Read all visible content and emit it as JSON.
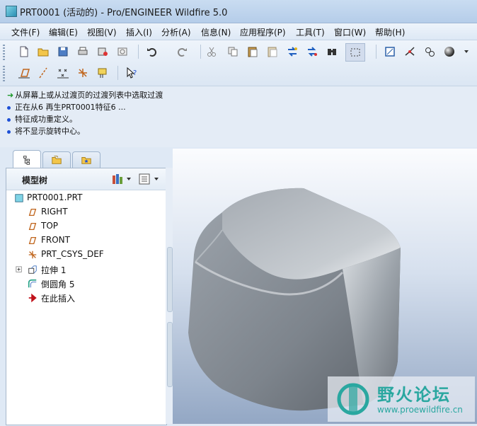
{
  "window": {
    "title": "PRT0001 (活动的) - Pro/ENGINEER Wildfire 5.0"
  },
  "menu": [
    {
      "label": "文件(F)"
    },
    {
      "label": "编辑(E)"
    },
    {
      "label": "视图(V)"
    },
    {
      "label": "插入(I)"
    },
    {
      "label": "分析(A)"
    },
    {
      "label": "信息(N)"
    },
    {
      "label": "应用程序(P)"
    },
    {
      "label": "工具(T)"
    },
    {
      "label": "窗口(W)"
    },
    {
      "label": "帮助(H)"
    }
  ],
  "toolbar": {
    "row1_icons": [
      "new-file-icon",
      "open-folder-icon",
      "save-icon",
      "print-icon",
      "save-copy-icon",
      "close-window-icon",
      "undo-icon",
      "redo-icon",
      "cut-icon",
      "copy-icon",
      "paste-icon",
      "paste-special-icon",
      "regenerate-icon",
      "regen-manager-icon",
      "find-icon",
      "select-box-icon",
      "repaint-icon",
      "spin-center-icon",
      "orient-icon",
      "shading-icon"
    ],
    "row2_icons": [
      "datum-plane-icon",
      "datum-axis-icon",
      "datum-point-icon",
      "datum-csys-icon",
      "annotation-icon",
      "context-help-icon"
    ]
  },
  "messages": [
    {
      "type": "prompt",
      "text": "从屏幕上或从过渡页的过渡列表中选取过渡"
    },
    {
      "type": "info",
      "text": "正在从6 再生PRT0001特征6 ..."
    },
    {
      "type": "info",
      "text": "特征成功重定义。"
    },
    {
      "type": "info",
      "text": "将不显示旋转中心。"
    }
  ],
  "panel": {
    "title": "模型树",
    "tabs": [
      "model-tree-tab-icon",
      "folder-browser-tab-icon",
      "favorites-tab-icon"
    ],
    "tree": [
      {
        "label": "PRT0001.PRT",
        "icon": "part-icon"
      },
      {
        "label": "RIGHT",
        "icon": "datum-plane-icon"
      },
      {
        "label": "TOP",
        "icon": "datum-plane-icon"
      },
      {
        "label": "FRONT",
        "icon": "datum-plane-icon"
      },
      {
        "label": "PRT_CSYS_DEF",
        "icon": "csys-icon"
      },
      {
        "label": "拉伸 1",
        "icon": "extrude-icon"
      },
      {
        "label": "倒圆角 5",
        "icon": "round-icon"
      },
      {
        "label": "在此插入",
        "icon": "insert-here-icon"
      }
    ]
  },
  "watermark": {
    "title": "野火论坛",
    "url": "www.proewildfire.cn"
  },
  "colors": {
    "accent": "#1d4fd6",
    "insert_arrow": "#c0121b",
    "model": "#a4aab2",
    "watermark": "#2aa7a0"
  }
}
